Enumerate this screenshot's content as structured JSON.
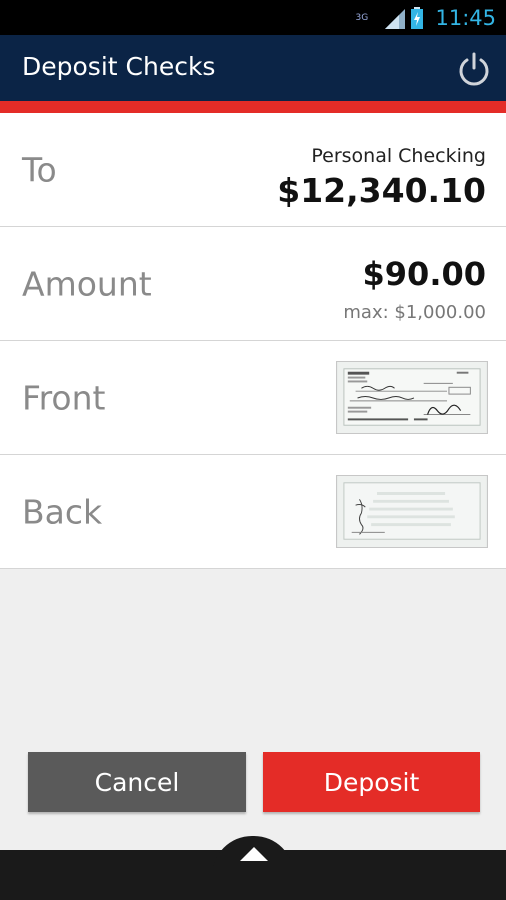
{
  "status_bar": {
    "network_type": "3G",
    "time": "11:45"
  },
  "header": {
    "title": "Deposit Checks",
    "power_icon": "power-icon"
  },
  "rows": {
    "to": {
      "label": "To",
      "account_name": "Personal Checking",
      "balance": "$12,340.10"
    },
    "amount": {
      "label": "Amount",
      "value": "$90.00",
      "max": "max: $1,000.00"
    },
    "front": {
      "label": "Front",
      "thumbnail_icon": "check-front-thumbnail"
    },
    "back": {
      "label": "Back",
      "thumbnail_icon": "check-back-thumbnail"
    }
  },
  "actions": {
    "cancel_label": "Cancel",
    "deposit_label": "Deposit"
  },
  "colors": {
    "header_bg": "#0b2446",
    "accent_red": "#e42c27",
    "cancel_bg": "#5a5a5a",
    "status_time": "#33b5e5"
  }
}
